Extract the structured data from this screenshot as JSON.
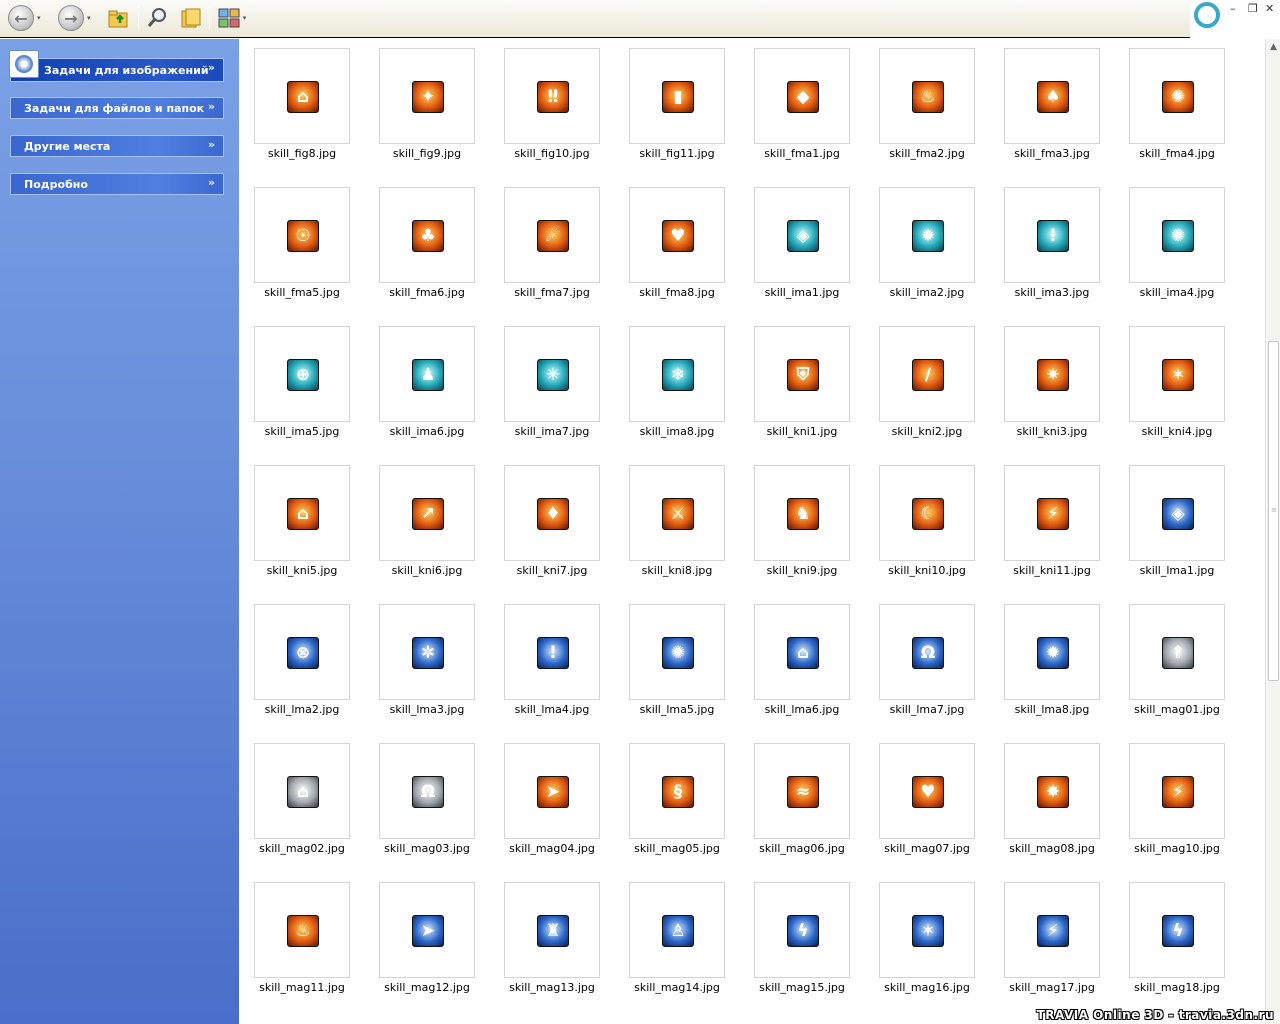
{
  "toolbar": {
    "back_icon": "←",
    "forward_icon": "→",
    "dropdown_glyph": "▾"
  },
  "window_controls": {
    "minimize": "–",
    "restore": "❐",
    "close": "✕"
  },
  "left_pane": {
    "tasks": [
      {
        "label": "Задачи для изображений",
        "chevron": "»"
      },
      {
        "label": "Задачи для файлов и папок",
        "chevron": "»"
      },
      {
        "label": "Другие места",
        "chevron": "»"
      },
      {
        "label": "Подробно",
        "chevron": "»"
      }
    ]
  },
  "files": [
    {
      "name": "skill_fig8.jpg",
      "glyph": "⌂",
      "tone": "fire"
    },
    {
      "name": "skill_fig9.jpg",
      "glyph": "✦",
      "tone": "fire"
    },
    {
      "name": "skill_fig10.jpg",
      "glyph": "‼",
      "tone": "fire"
    },
    {
      "name": "skill_fig11.jpg",
      "glyph": "▮",
      "tone": "fire"
    },
    {
      "name": "skill_fma1.jpg",
      "glyph": "◆",
      "tone": "fire"
    },
    {
      "name": "skill_fma2.jpg",
      "glyph": "♨",
      "tone": "fire"
    },
    {
      "name": "skill_fma3.jpg",
      "glyph": "♠",
      "tone": "fire"
    },
    {
      "name": "skill_fma4.jpg",
      "glyph": "✺",
      "tone": "fire"
    },
    {
      "name": "skill_fma5.jpg",
      "glyph": "☉",
      "tone": "fire"
    },
    {
      "name": "skill_fma6.jpg",
      "glyph": "♣",
      "tone": "fire"
    },
    {
      "name": "skill_fma7.jpg",
      "glyph": "☄",
      "tone": "fire"
    },
    {
      "name": "skill_fma8.jpg",
      "glyph": "♥",
      "tone": "fire"
    },
    {
      "name": "skill_ima1.jpg",
      "glyph": "◈",
      "tone": "ice"
    },
    {
      "name": "skill_ima2.jpg",
      "glyph": "✹",
      "tone": "ice"
    },
    {
      "name": "skill_ima3.jpg",
      "glyph": "!",
      "tone": "ice"
    },
    {
      "name": "skill_ima4.jpg",
      "glyph": "✺",
      "tone": "ice"
    },
    {
      "name": "skill_ima5.jpg",
      "glyph": "⊕",
      "tone": "ice"
    },
    {
      "name": "skill_ima6.jpg",
      "glyph": "♟",
      "tone": "ice"
    },
    {
      "name": "skill_ima7.jpg",
      "glyph": "✳",
      "tone": "ice"
    },
    {
      "name": "skill_ima8.jpg",
      "glyph": "❄",
      "tone": "ice"
    },
    {
      "name": "skill_kni1.jpg",
      "glyph": "⛨",
      "tone": "fire"
    },
    {
      "name": "skill_kni2.jpg",
      "glyph": "/",
      "tone": "fire"
    },
    {
      "name": "skill_kni3.jpg",
      "glyph": "✷",
      "tone": "fire"
    },
    {
      "name": "skill_kni4.jpg",
      "glyph": "✶",
      "tone": "fire"
    },
    {
      "name": "skill_kni5.jpg",
      "glyph": "⌂",
      "tone": "fire"
    },
    {
      "name": "skill_kni6.jpg",
      "glyph": "↗",
      "tone": "fire"
    },
    {
      "name": "skill_kni7.jpg",
      "glyph": "♦",
      "tone": "fire"
    },
    {
      "name": "skill_kni8.jpg",
      "glyph": "⚔",
      "tone": "fire"
    },
    {
      "name": "skill_kni9.jpg",
      "glyph": "♞",
      "tone": "fire"
    },
    {
      "name": "skill_kni10.jpg",
      "glyph": "☾",
      "tone": "fire"
    },
    {
      "name": "skill_kni11.jpg",
      "glyph": "⚡",
      "tone": "fire"
    },
    {
      "name": "skill_lma1.jpg",
      "glyph": "◈",
      "tone": "blue"
    },
    {
      "name": "skill_lma2.jpg",
      "glyph": "⊗",
      "tone": "blue"
    },
    {
      "name": "skill_lma3.jpg",
      "glyph": "✲",
      "tone": "blue"
    },
    {
      "name": "skill_lma4.jpg",
      "glyph": "!",
      "tone": "blue"
    },
    {
      "name": "skill_lma5.jpg",
      "glyph": "✺",
      "tone": "blue"
    },
    {
      "name": "skill_lma6.jpg",
      "glyph": "⌂",
      "tone": "blue"
    },
    {
      "name": "skill_lma7.jpg",
      "glyph": "Ω",
      "tone": "blue"
    },
    {
      "name": "skill_lma8.jpg",
      "glyph": "✹",
      "tone": "blue"
    },
    {
      "name": "skill_mag01.jpg",
      "glyph": "⇑",
      "tone": "gray"
    },
    {
      "name": "skill_mag02.jpg",
      "glyph": "⌂",
      "tone": "gray"
    },
    {
      "name": "skill_mag03.jpg",
      "glyph": "Ω",
      "tone": "gray"
    },
    {
      "name": "skill_mag04.jpg",
      "glyph": "➤",
      "tone": "fire"
    },
    {
      "name": "skill_mag05.jpg",
      "glyph": "§",
      "tone": "fire"
    },
    {
      "name": "skill_mag06.jpg",
      "glyph": "≈",
      "tone": "fire"
    },
    {
      "name": "skill_mag07.jpg",
      "glyph": "♥",
      "tone": "fire"
    },
    {
      "name": "skill_mag08.jpg",
      "glyph": "✸",
      "tone": "fire"
    },
    {
      "name": "skill_mag10.jpg",
      "glyph": "⚡",
      "tone": "fire"
    },
    {
      "name": "skill_mag11.jpg",
      "glyph": "♨",
      "tone": "fire"
    },
    {
      "name": "skill_mag12.jpg",
      "glyph": "➤",
      "tone": "blue"
    },
    {
      "name": "skill_mag13.jpg",
      "glyph": "♜",
      "tone": "blue"
    },
    {
      "name": "skill_mag14.jpg",
      "glyph": "♙",
      "tone": "blue"
    },
    {
      "name": "skill_mag15.jpg",
      "glyph": "ϟ",
      "tone": "blue"
    },
    {
      "name": "skill_mag16.jpg",
      "glyph": "✶",
      "tone": "blue"
    },
    {
      "name": "skill_mag17.jpg",
      "glyph": "⚡",
      "tone": "blue"
    },
    {
      "name": "skill_mag18.jpg",
      "glyph": "ϟ",
      "tone": "blue"
    }
  ],
  "watermark": "TRAVIA Online 3D - travia.3dn.ru"
}
